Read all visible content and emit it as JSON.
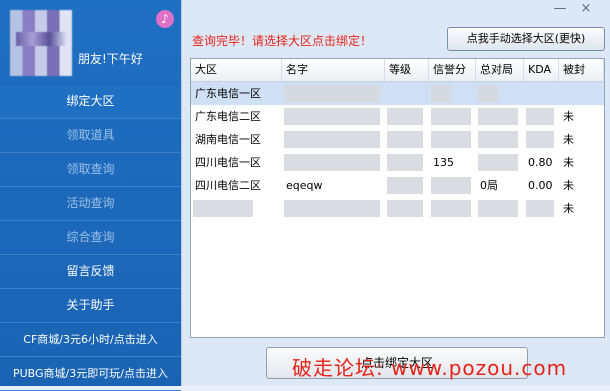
{
  "sidebar": {
    "greeting": "朋友!下午好",
    "items": [
      {
        "label": "绑定大区",
        "state": "active"
      },
      {
        "label": "领取道具",
        "state": "disabled"
      },
      {
        "label": "领取查询",
        "state": "disabled"
      },
      {
        "label": "活动查询",
        "state": "disabled"
      },
      {
        "label": "综合查询",
        "state": "disabled"
      },
      {
        "label": "留言反馈",
        "state": "normal"
      },
      {
        "label": "关于助手",
        "state": "normal"
      },
      {
        "label": "CF商城/3元6小时/点击进入",
        "state": "normal"
      },
      {
        "label": "PUBG商城/3元即可玩/点击进入",
        "state": "normal"
      }
    ]
  },
  "window": {
    "minimize": "—",
    "close": "×"
  },
  "status_text": "查询完毕！请选择大区点击绑定！",
  "manual_button": "点我手动选择大区(更快)",
  "table": {
    "columns": [
      "大区",
      "名字",
      "等级",
      "信誉分",
      "总对局",
      "KDA",
      "被封"
    ],
    "rows": [
      {
        "region": "广东电信一区",
        "name": "",
        "level": "",
        "credit": "",
        "games": "",
        "kda": "",
        "banned": ""
      },
      {
        "region": "广东电信二区",
        "name": "",
        "level": "",
        "credit": "",
        "games": "",
        "kda": "",
        "banned": "未"
      },
      {
        "region": "湖南电信一区",
        "name": "",
        "level": "",
        "credit": "",
        "games": "",
        "kda": "",
        "banned": "未"
      },
      {
        "region": "四川电信一区",
        "name": "",
        "level": "",
        "credit": "135",
        "games": "",
        "kda": "0.80",
        "banned": "未"
      },
      {
        "region": "四川电信二区",
        "name": "eqeqw",
        "level": "",
        "credit": "",
        "games": "0局",
        "kda": "0.00",
        "banned": "未"
      },
      {
        "region": "",
        "name": "",
        "level": "",
        "credit": "",
        "games": "",
        "kda": "",
        "banned": "未"
      }
    ]
  },
  "bind_button": "点击绑定大区",
  "watermark": "破走论坛: www.pozou.com"
}
